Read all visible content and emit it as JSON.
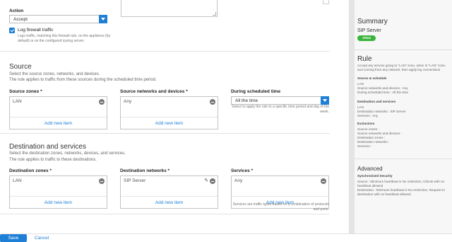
{
  "action": {
    "label": "Action",
    "selected": "Accept",
    "log_label": "Log firewall traffic",
    "log_help": [
      "Logs traffic, matching this firewall rule, on the appliance (by",
      "default) or on the configured syslog server."
    ]
  },
  "source": {
    "title": "Source",
    "desc1": "Select the source zones, networks, and devices.",
    "desc2": "The rule applies to traffic from these sources during the scheduled time period.",
    "zones_label": "Source zones",
    "zones_value": "LAN",
    "networks_label": "Source networks and devices",
    "networks_value": "Any",
    "schedule_label": "During scheduled time",
    "schedule_value": "All the time",
    "schedule_help": "Select to apply the rule to a specific time period and day of the week.",
    "add_label": "Add new item"
  },
  "destination": {
    "title": "Destination and services",
    "desc1": "Select the destination zones, networks, devices, and services.",
    "desc2": "The rule applies to traffic to these destinations.",
    "zones_label": "Destination zones",
    "zones_value": "LAN",
    "networks_label": "Destination networks",
    "networks_value": "SIP Server",
    "services_label": "Services",
    "services_value": "Any",
    "services_help": "Services are traffic types based on a combination of protocols and ports.",
    "add_label": "Add new item"
  },
  "required_mark": "*",
  "footer": {
    "save": "Save",
    "cancel": "Cancel"
  },
  "summary": {
    "title": "Summary",
    "rule_name": "SIP Server",
    "badge": "Allow",
    "rule_title": "Rule",
    "rule_desc": "Accept any service going to \"LAN\" zone, when in \"LAN\" zone, and coming from any network, then apply log connections",
    "src_sched_head": "Source & schedule",
    "src_sched_lines": [
      "LAN",
      "Source networks and devices : Any",
      "During scheduled time : All the time"
    ],
    "dst_svc_head": "Destination and services",
    "dst_svc_lines": [
      "LAN",
      "Destination networks : SIP Server",
      "Services : Any"
    ],
    "excl_head": "Exclusions",
    "excl_lines": [
      "Source zones :",
      "Source networks and devices :",
      "Destination zones :",
      "Destination networks :",
      "Services :"
    ],
    "advanced_title": "Advanced",
    "sync_head": "Synchronized Security",
    "sync_text": "Source : Minimum heartbeat is No restriction, Clients with no heartbeat allowed",
    "sync_text2": "Destination : Minimum heartbeat is No restriction, Request to destination with no heartbeat allowed"
  },
  "colors": {
    "accent": "#1e7fd6",
    "allow": "#3ab43a"
  },
  "icons": [
    "check-icon",
    "chevron-down-icon",
    "remove-icon",
    "pencil-icon"
  ]
}
